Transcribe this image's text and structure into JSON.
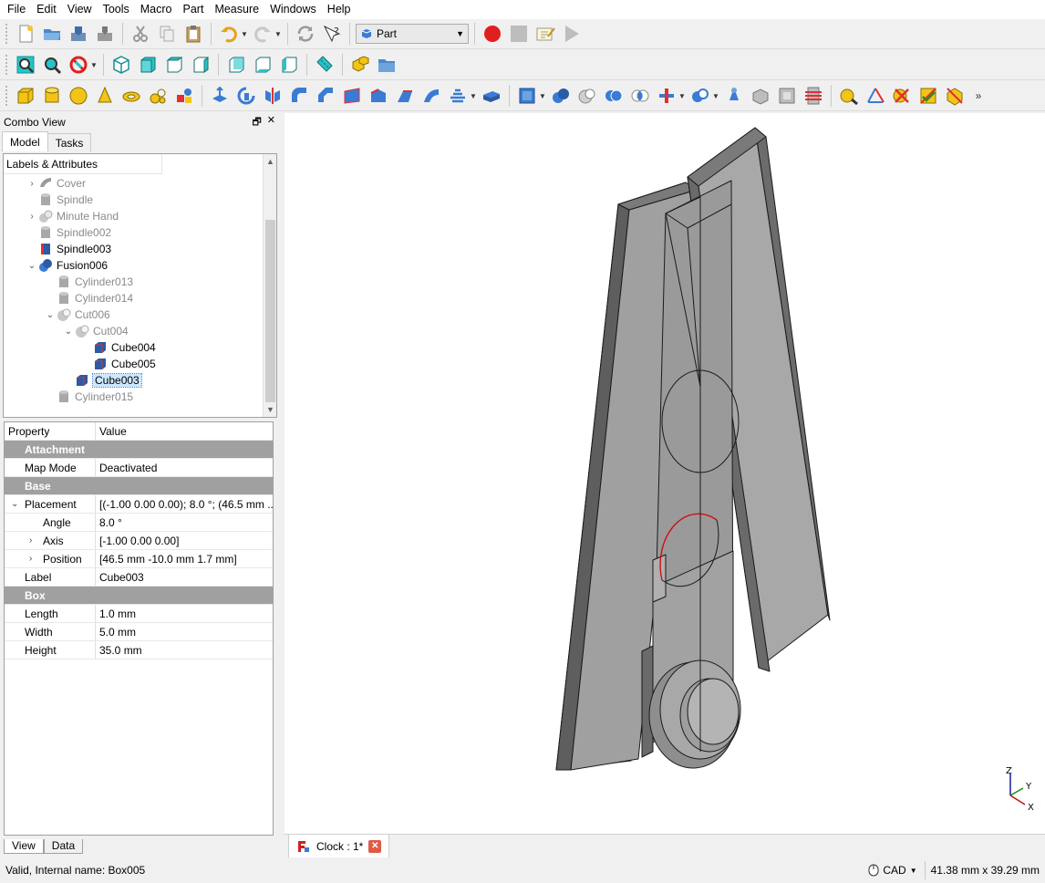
{
  "menu": [
    "File",
    "Edit",
    "View",
    "Tools",
    "Macro",
    "Part",
    "Measure",
    "Windows",
    "Help"
  ],
  "workbench": {
    "label": "Part"
  },
  "combo": {
    "title": "Combo View",
    "tabs": [
      "Model",
      "Tasks"
    ]
  },
  "tree": {
    "header": "Labels & Attributes",
    "items": [
      {
        "label": "Cover",
        "icon": "cover-icon"
      },
      {
        "label": "Spindle",
        "icon": "cylinder-icon"
      },
      {
        "label": "Minute Hand",
        "icon": "minute-hand-icon"
      },
      {
        "label": "Spindle002",
        "icon": "cylinder-icon"
      },
      {
        "label": "Spindle003",
        "icon": "cut-cube-icon"
      },
      {
        "label": "Fusion006",
        "icon": "fusion-icon"
      },
      {
        "label": "Cylinder013",
        "icon": "cylinder-icon"
      },
      {
        "label": "Cylinder014",
        "icon": "cylinder-icon"
      },
      {
        "label": "Cut006",
        "icon": "cut-icon"
      },
      {
        "label": "Cut004",
        "icon": "cut-icon"
      },
      {
        "label": "Cube004",
        "icon": "cube-icon"
      },
      {
        "label": "Cube005",
        "icon": "cube-icon"
      },
      {
        "label": "Cube003",
        "icon": "cube-icon"
      },
      {
        "label": "Cylinder015",
        "icon": "cylinder-icon"
      }
    ]
  },
  "properties": {
    "col_property": "Property",
    "col_value": "Value",
    "rows": [
      {
        "type": "group",
        "key": "Attachment"
      },
      {
        "type": "row",
        "key": "Map Mode",
        "value": "Deactivated"
      },
      {
        "type": "group",
        "key": "Base"
      },
      {
        "type": "row",
        "key": "Placement",
        "value": "[(-1.00 0.00 0.00); 8.0 °; (46.5 mm  ...",
        "expander": "⌄"
      },
      {
        "type": "sub",
        "key": "Angle",
        "value": "8.0 °"
      },
      {
        "type": "sub",
        "key": "Axis",
        "value": "[-1.00 0.00 0.00]",
        "expander": "›"
      },
      {
        "type": "sub",
        "key": "Position",
        "value": "[46.5 mm  -10.0 mm  1.7 mm]",
        "expander": "›"
      },
      {
        "type": "row",
        "key": "Label",
        "value": "Cube003"
      },
      {
        "type": "group",
        "key": "Box"
      },
      {
        "type": "row",
        "key": "Length",
        "value": "1.0 mm"
      },
      {
        "type": "row",
        "key": "Width",
        "value": "5.0 mm"
      },
      {
        "type": "row",
        "key": "Height",
        "value": "35.0 mm"
      }
    ]
  },
  "bottom_tabs": [
    "View",
    "Data"
  ],
  "document_tab": {
    "label": "Clock : 1*"
  },
  "axis": {
    "z": "Z",
    "y": "Y",
    "x": "X"
  },
  "status": {
    "message": "Valid, Internal name: Box005",
    "nav_style": "CAD",
    "dimensions": "41.38 mm x 39.29 mm"
  },
  "colors": {
    "accent_record": "#e0201f",
    "selection": "#cce8ff",
    "group_header": "#a0a0a0"
  }
}
